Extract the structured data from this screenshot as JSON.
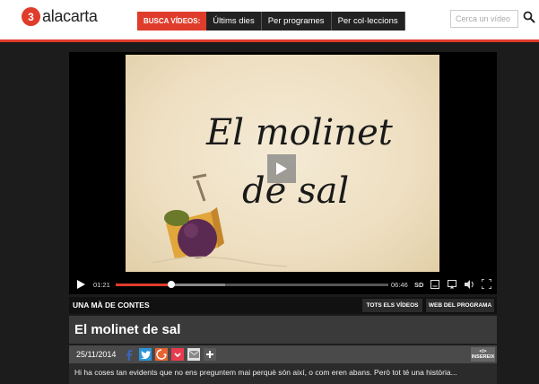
{
  "header": {
    "logo_number": "3",
    "logo_text": "alacarta",
    "nav": {
      "busca_label": "BUSCA VÍDEOS:",
      "items": [
        "Últims dies",
        "Per programes",
        "Per col·leccions"
      ]
    },
    "search_placeholder": "Cerca un vídeo",
    "accent": "#e03c2b"
  },
  "player": {
    "art_title_line1": "El molinet",
    "art_title_line2": "de sal",
    "current_time": "01:21",
    "duration": "06:46",
    "quality": "SD",
    "progress_fraction": 0.2
  },
  "program": {
    "name": "UNA MÀ DE CONTES",
    "all_videos_label": "TOTS ELS VÍDEOS",
    "program_web_label": "WEB DEL PROGRAMA"
  },
  "episode": {
    "title": "El molinet de sal",
    "date": "25/11/2014",
    "embed_icon_label": "</>",
    "embed_label": "INSEREIX",
    "description": "Hi ha coses tan evidents que no ens preguntem mai perquè són així, o com eren abans. Però tot té una història..."
  },
  "share_icons": [
    "facebook-icon",
    "twitter-icon",
    "google-plus-icon",
    "pocket-icon",
    "email-icon",
    "plus-icon"
  ]
}
